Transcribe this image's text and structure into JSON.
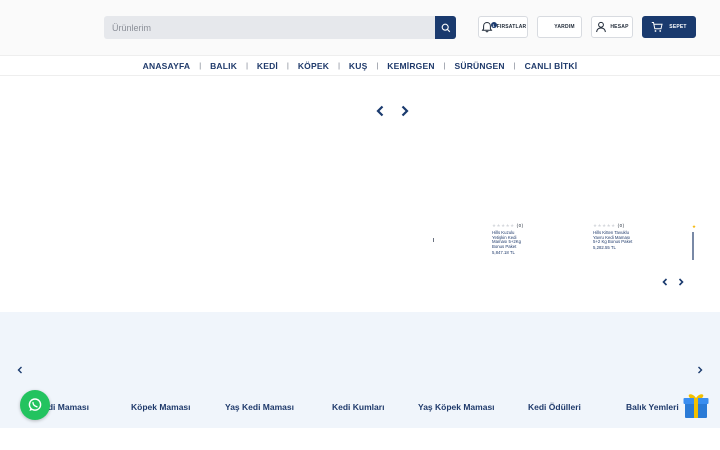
{
  "header": {
    "search": {
      "placeholder": "Ürünlerim",
      "value": ""
    },
    "buttons": {
      "deals": {
        "label": "FIRSATLAR",
        "icon": "bell-icon",
        "badge": "1"
      },
      "help": {
        "label": "YARDIM"
      },
      "account": {
        "label": "HESAP",
        "icon": "user-icon"
      },
      "cart": {
        "label": "SEPET",
        "icon": "cart-icon"
      }
    }
  },
  "nav": {
    "items": [
      "ANASAYFA",
      "BALIK",
      "KEDİ",
      "KÖPEK",
      "KUŞ",
      "KEMİRGEN",
      "SÜRÜNGEN",
      "CANLI BİTKİ"
    ]
  },
  "products": [
    {
      "reviews": "(0)",
      "name": "Hills Kuzulu Yetişkin Kedi Maması 5+2Kg Bonus Paket",
      "price": "5,847.18 TL"
    },
    {
      "reviews": "(0)",
      "name": "Hills Kitten Tavuklu Yavru Kedi Maması 5+2 Kg Bonus Paket",
      "price": "5,282.55 TL"
    }
  ],
  "categories": [
    "Kedi Maması",
    "Köpek Maması",
    "Yaş Kedi Maması",
    "Kedi Kumları",
    "Yaş Köpek Maması",
    "Kedi Ödülleri",
    "Balık Yemleri"
  ],
  "colors": {
    "brand": "#1a3a6e",
    "whatsapp": "#23c35f",
    "band": "#f0f5fb"
  }
}
